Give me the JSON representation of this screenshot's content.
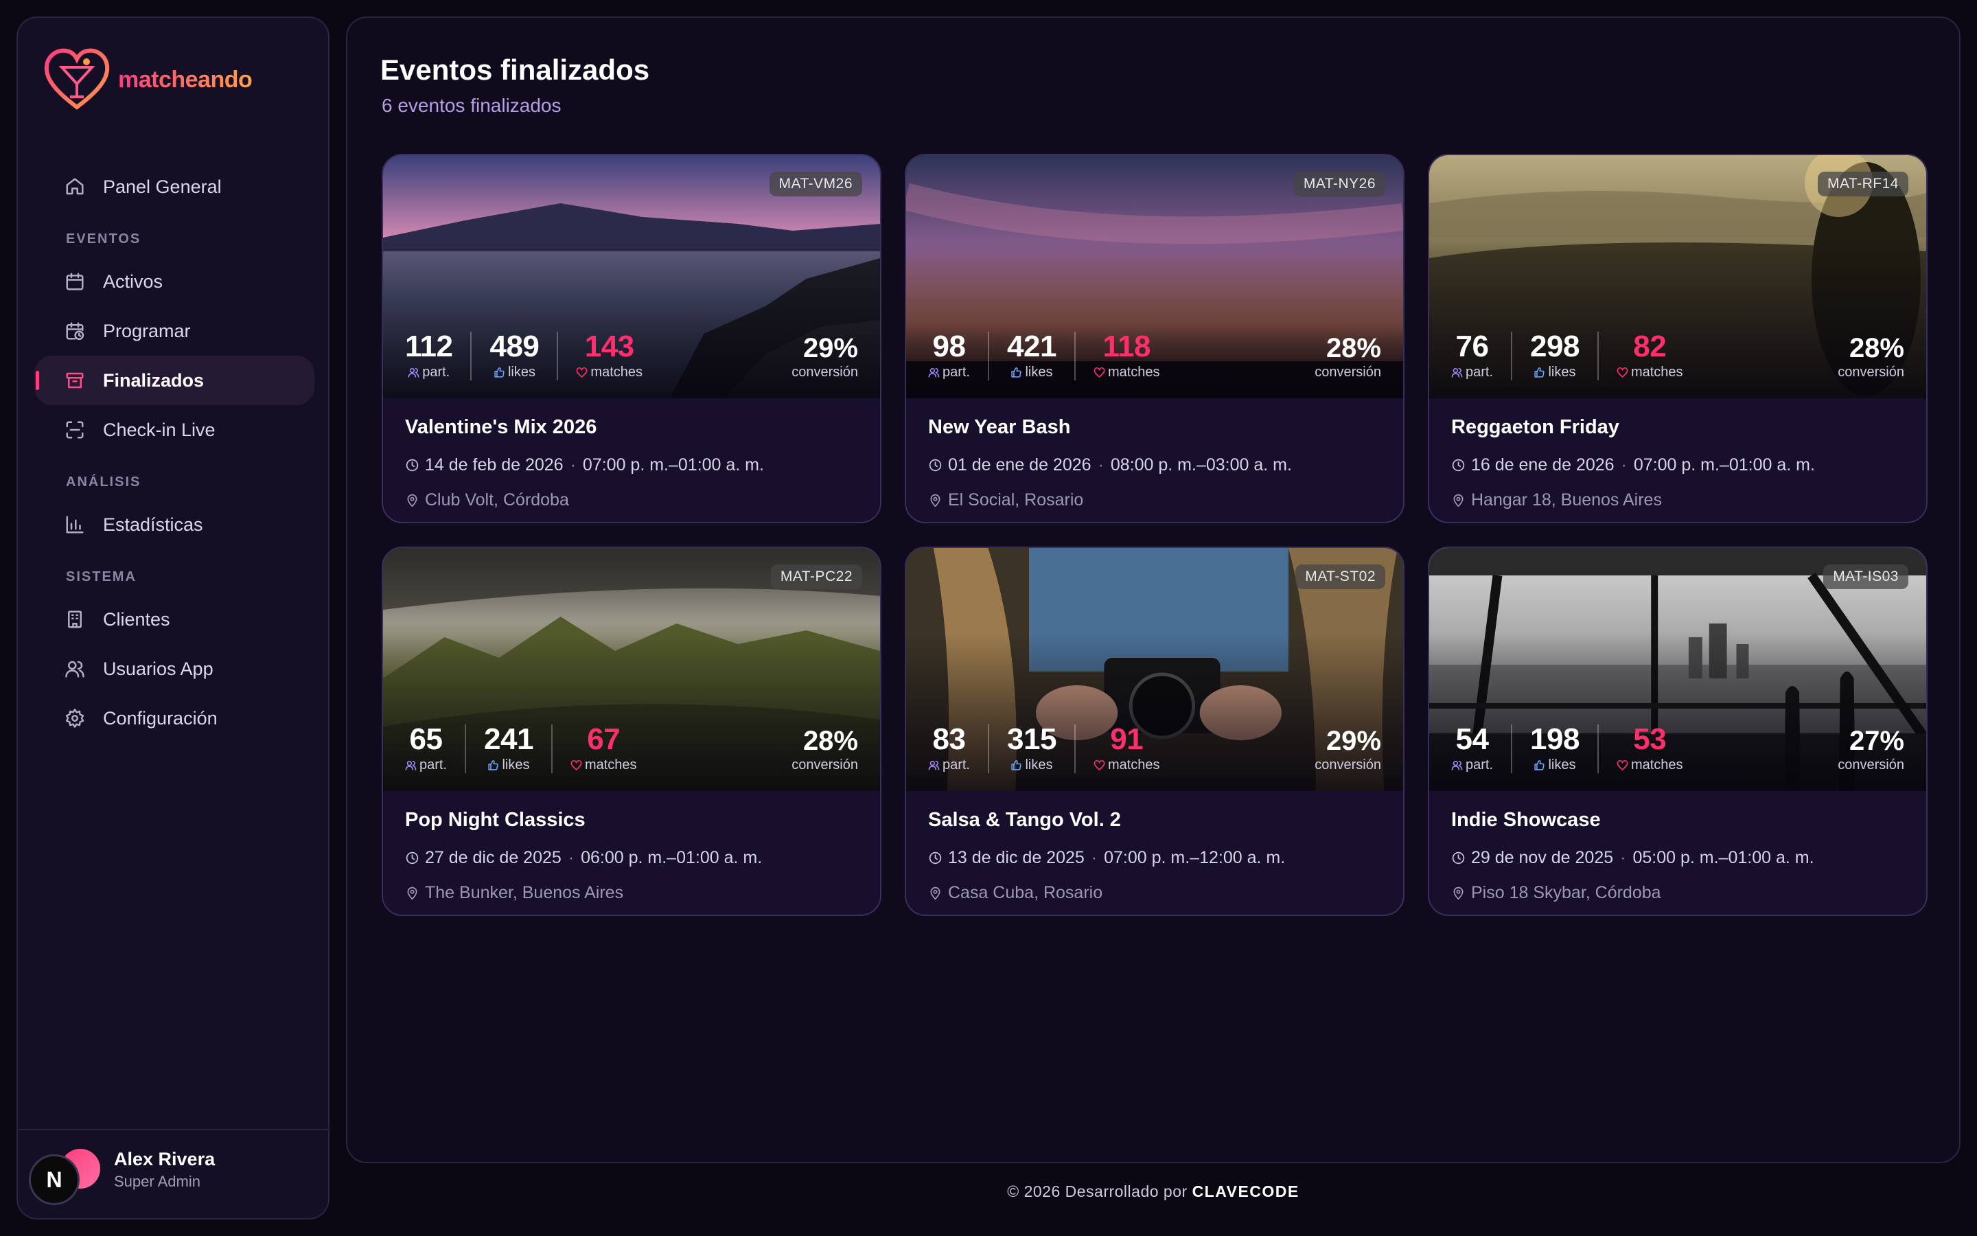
{
  "app": {
    "brand": "matcheando"
  },
  "sidebar": {
    "items": [
      {
        "label": "Panel General",
        "icon": "home-icon"
      },
      {
        "section": "EVENTOS"
      },
      {
        "label": "Activos",
        "icon": "calendar-icon"
      },
      {
        "label": "Programar",
        "icon": "calendar-clock-icon"
      },
      {
        "label": "Finalizados",
        "icon": "archive-icon",
        "active": true
      },
      {
        "label": "Check-in Live",
        "icon": "scan-icon"
      },
      {
        "section": "ANÁLISIS"
      },
      {
        "label": "Estadísticas",
        "icon": "bar-chart-icon"
      },
      {
        "section": "SISTEMA"
      },
      {
        "label": "Clientes",
        "icon": "building-icon"
      },
      {
        "label": "Usuarios App",
        "icon": "users-icon"
      },
      {
        "label": "Configuración",
        "icon": "settings-icon"
      }
    ],
    "user": {
      "initial": "N",
      "name": "Alex Rivera",
      "role": "Super Admin"
    }
  },
  "main": {
    "title": "Eventos finalizados",
    "subtitle": "6 eventos finalizados",
    "labels": {
      "participants": "part.",
      "likes": "likes",
      "matches": "matches",
      "conversion": "conversión"
    },
    "events": [
      {
        "code": "MAT-VM26",
        "participants": "112",
        "likes": "489",
        "matches": "143",
        "conversion": "29%",
        "title": "Valentine's Mix 2026",
        "date": "14 de feb de 2026",
        "time": "07:00 p. m.–01:00 a. m.",
        "location": "Club Volt, Córdoba"
      },
      {
        "code": "MAT-NY26",
        "participants": "98",
        "likes": "421",
        "matches": "118",
        "conversion": "28%",
        "title": "New Year Bash",
        "date": "01 de ene de 2026",
        "time": "08:00 p. m.–03:00 a. m.",
        "location": "El Social, Rosario"
      },
      {
        "code": "MAT-RF14",
        "participants": "76",
        "likes": "298",
        "matches": "82",
        "conversion": "28%",
        "title": "Reggaeton Friday",
        "date": "16 de ene de 2026",
        "time": "07:00 p. m.–01:00 a. m.",
        "location": "Hangar 18, Buenos Aires"
      },
      {
        "code": "MAT-PC22",
        "participants": "65",
        "likes": "241",
        "matches": "67",
        "conversion": "28%",
        "title": "Pop Night Classics",
        "date": "27 de dic de 2025",
        "time": "06:00 p. m.–01:00 a. m.",
        "location": "The Bunker, Buenos Aires"
      },
      {
        "code": "MAT-ST02",
        "participants": "83",
        "likes": "315",
        "matches": "91",
        "conversion": "29%",
        "title": "Salsa & Tango Vol. 2",
        "date": "13 de dic de 2025",
        "time": "07:00 p. m.–12:00 a. m.",
        "location": "Casa Cuba, Rosario"
      },
      {
        "code": "MAT-IS03",
        "participants": "54",
        "likes": "198",
        "matches": "53",
        "conversion": "27%",
        "title": "Indie Showcase",
        "date": "29 de nov de 2025",
        "time": "05:00 p. m.–01:00 a. m.",
        "location": "Piso 18 Skybar, Córdoba"
      }
    ]
  },
  "footer": {
    "text": "© 2026 Desarrollado por",
    "brand": "CLAVECODE"
  },
  "colors": {
    "accent": "#ff3d7f",
    "accent2": "#ffa149",
    "match": "#ff2f6e",
    "likes": "#6ea8ff",
    "participants": "#a98bff"
  }
}
